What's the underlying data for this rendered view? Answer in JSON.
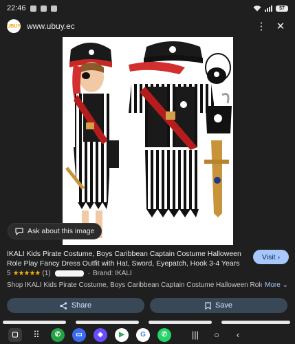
{
  "status_bar": {
    "time": "22:46",
    "battery": "57"
  },
  "browser": {
    "url": "www.ubuy.ec",
    "logo_text": "UBUY"
  },
  "ask_chip": {
    "label": "Ask about this image"
  },
  "product": {
    "title": "IKALI Kids Pirate Costume, Boys Caribbean Captain Costume Halloween Role Play Fancy Dress Outfit with Hat, Sword, Eyepatch, Hook 3-4 Years",
    "rating": "5",
    "stars": "★★★★★",
    "review_count": "(1)",
    "brand_prefix": "·",
    "brand": "Brand: IKALI",
    "description": "Shop IKALI Kids Pirate Costume, Boys Caribbean Captain Costume Halloween Role...",
    "more_label": "More"
  },
  "actions": {
    "visit_label": "Visit",
    "share_label": "Share",
    "save_label": "Save"
  },
  "colors": {
    "visit_bg": "#a8c7fa",
    "action_bg": "#394857",
    "star": "#f4b400",
    "background": "#1f1f1f"
  },
  "dock": {
    "apps": [
      {
        "name": "grid-icon",
        "color": "#1f1f1f"
      },
      {
        "name": "phone-icon",
        "color": "#25a244"
      },
      {
        "name": "messages-icon",
        "color": "#3b6cf0"
      },
      {
        "name": "browser-icon",
        "color": "#6a4cff"
      },
      {
        "name": "play-store-icon",
        "color": "#ffffff"
      },
      {
        "name": "google-icon",
        "color": "#ffffff"
      },
      {
        "name": "whatsapp-icon",
        "color": "#25d366"
      }
    ]
  }
}
